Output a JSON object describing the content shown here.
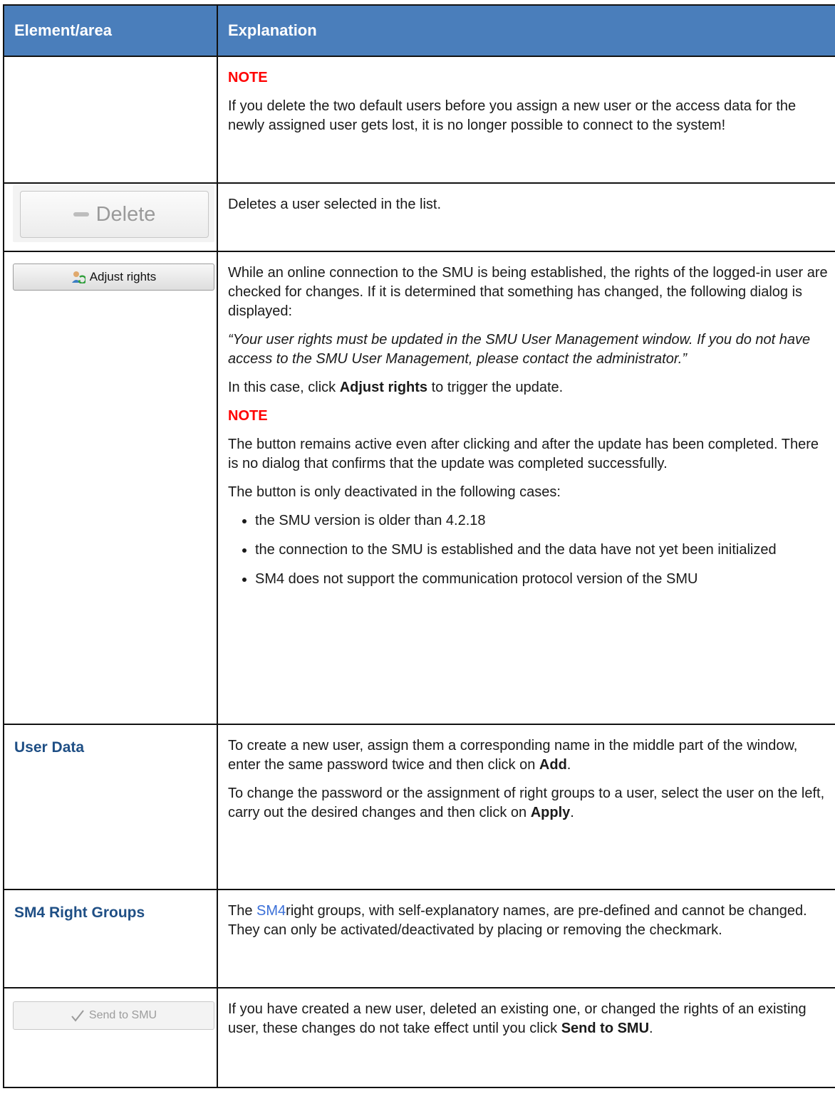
{
  "table": {
    "header_col1": "Element/area",
    "header_col2": "Explanation"
  },
  "rows": {
    "r1": {
      "note_label": "NOTE",
      "text": "If you delete the two default users before you assign a new user or the access data for the newly assigned user gets lost, it is no longer possible to connect to the system!"
    },
    "r2": {
      "button_label": "Delete",
      "text": "Deletes a user selected in the list."
    },
    "r3": {
      "button_label": "Adjust rights",
      "p1": "While an online connection to the SMU is being established, the rights of the logged-in user are checked for changes. If it is determined that something has changed, the following dialog is displayed:",
      "quote": "“Your user rights must be updated in the SMU User Management window. If you do not have access to the SMU User Management, please contact the administrator.”",
      "p3_pre": "In this case, click ",
      "p3_bold": "Adjust rights",
      "p3_post": " to trigger the update.",
      "note_label": "NOTE",
      "p4": "The button remains active even after clicking and after the update has been completed. There is no dialog that confirms that the update was completed successfully.",
      "p5": "The button is only deactivated in the following cases:",
      "bullets": [
        "the SMU version is older than 4.2.18",
        "the connection to the SMU is established and the data have not yet been initialized",
        "SM4 does not support the communication protocol version of the SMU"
      ]
    },
    "r4": {
      "label": "User Data",
      "p1_pre": "To create a new user, assign them a corresponding name in the middle part of the window, enter the same password twice and then click on ",
      "p1_bold": "Add",
      "p1_post": ".",
      "p2_pre": "To change the password or the assignment of right groups to a user, select the user on the left, carry out the desired changes and then click on ",
      "p2_bold": "Apply",
      "p2_post": "."
    },
    "r5": {
      "label": "SM4 Right Groups",
      "p_pre": "The ",
      "p_link": "SM4",
      "p_post": "right groups, with self-explanatory names, are pre-defined and cannot be changed. They can only be activated/deactivated by placing or removing the checkmark."
    },
    "r6": {
      "button_label": "Send to SMU",
      "p_pre": "If you have created a new user, deleted an existing one, or changed the rights of an existing user, these changes do not take effect until you click ",
      "p_bold": "Send to SMU",
      "p_post": "."
    }
  },
  "colors": {
    "header_bg": "#4a7ebb",
    "note": "#ff0000",
    "label": "#1f4f85",
    "link": "#3a6fd8"
  }
}
